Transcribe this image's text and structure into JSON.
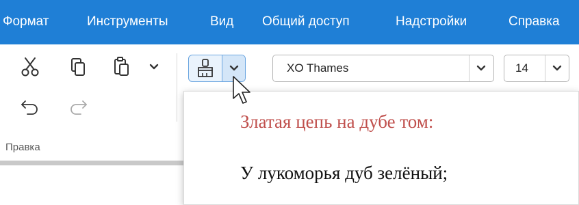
{
  "menubar": {
    "bg_color": "#1f7fd6",
    "items": [
      {
        "label": "Формат"
      },
      {
        "label": "Инструменты"
      },
      {
        "label": "Вид"
      },
      {
        "label": "Общий доступ"
      },
      {
        "label": "Надстройки"
      },
      {
        "label": "Справка"
      }
    ]
  },
  "ribbon": {
    "edit_group": {
      "label": "Правка",
      "tools": [
        "cut-icon",
        "copy-icon",
        "paste-icon",
        "paste-options-chevron-icon",
        "undo-icon",
        "redo-icon"
      ]
    },
    "format_painter": {
      "icon": "brush-icon",
      "active_color": "#6aa5e0"
    },
    "font": {
      "name": "XO Thames",
      "size": "14"
    }
  },
  "preview": {
    "line1": "Златая цепь на дубе том:",
    "line1_color": "#c0504d",
    "line2": "У лукоморья дуб зелёный;"
  }
}
